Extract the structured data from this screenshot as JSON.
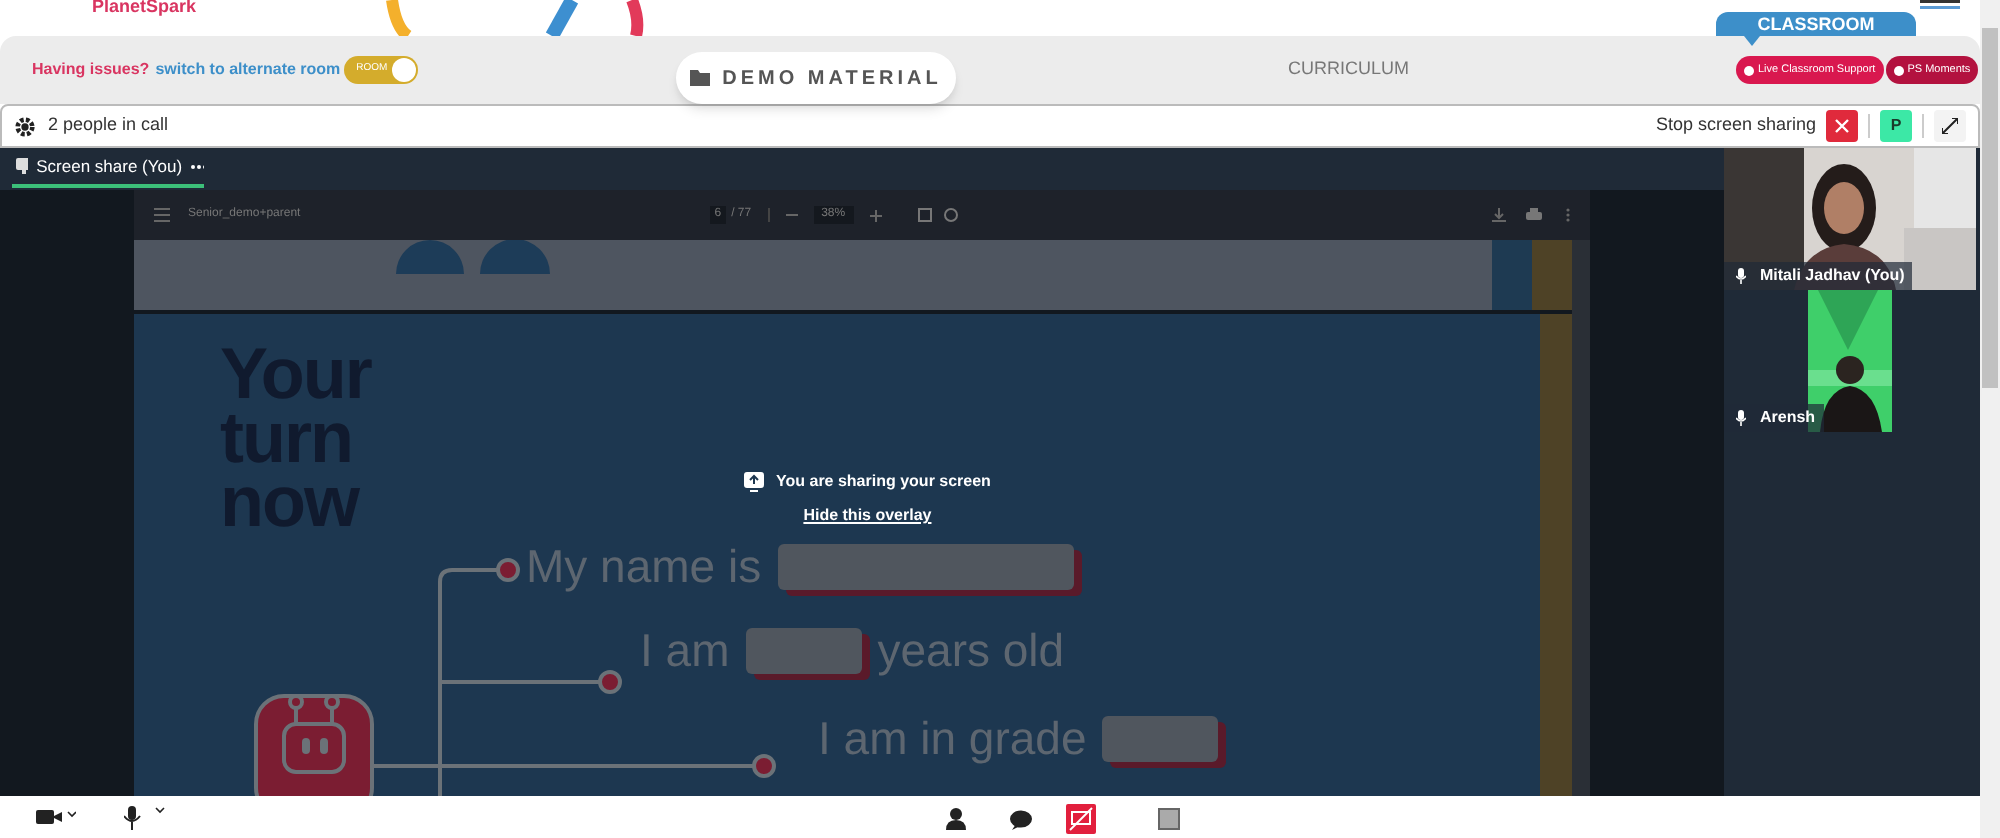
{
  "logo": {
    "text": "PlanetSpark"
  },
  "top_bar": {
    "issue_text": "Having issues?",
    "switch_link": "switch to alternate room",
    "room_toggle": {
      "label": "ROOM",
      "on": true
    },
    "demo_button": "DEMO MATERIAL",
    "curriculum": "CURRICULUM",
    "classroom_tab": "CLASSROOM",
    "pill_buttons": [
      {
        "label": "Live Classroom Support",
        "color": "#d9184f"
      },
      {
        "label": "PS Moments",
        "color": "#b3123f"
      }
    ]
  },
  "call_header": {
    "people": "2 people in call",
    "stop_sharing": "Stop screen sharing",
    "participant_initial": "P"
  },
  "tabs": [
    {
      "label": "Screen share (You)",
      "selected": true
    }
  ],
  "pdf_viewer": {
    "file": "Senior_demo+parent",
    "page": "6",
    "pages": "/ 77",
    "zoom": "38%"
  },
  "slide": {
    "title_lines": [
      "Your",
      "turn",
      "now"
    ],
    "lines": [
      {
        "before": "My name is"
      },
      {
        "before": "I am",
        "after": "years old"
      },
      {
        "before": "I am in grade"
      }
    ]
  },
  "overlay": {
    "message": "You are sharing your screen",
    "link": "Hide this overlay"
  },
  "participants": [
    {
      "name": "Mitali Jadhav (You)"
    },
    {
      "name": "Arensh"
    }
  ],
  "bottom_bar": {
    "share_active": true
  }
}
